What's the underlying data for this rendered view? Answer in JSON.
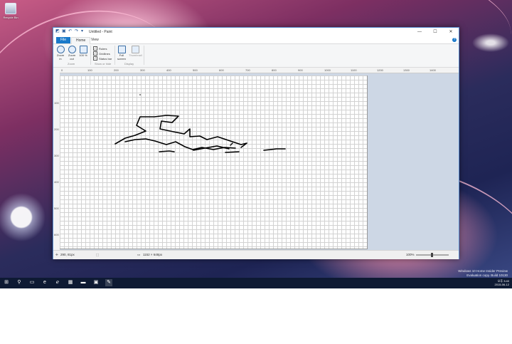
{
  "desktop": {
    "recycle_bin_label": "Recycle Bin"
  },
  "window": {
    "title": "Untitled - Paint",
    "controls": {
      "minimize": "—",
      "maximize": "☐",
      "close": "✕"
    }
  },
  "ribbon": {
    "tabs": [
      "File",
      "Home",
      "View"
    ],
    "zoom_group": {
      "zoom_in": "Zoom in",
      "zoom_out": "Zoom out",
      "hundred": "100 %",
      "label": "Zoom"
    },
    "show_hide": {
      "rulers": "Rulers",
      "gridlines": "Gridlines",
      "status_bar": "Status bar",
      "label": "Show or hide"
    },
    "display": {
      "full_screen": "Full screen",
      "thumbnail": "Thumbnail",
      "label": "Display"
    }
  },
  "rulers": {
    "horizontal": [
      "0",
      "100",
      "200",
      "300",
      "400",
      "500",
      "600",
      "700",
      "800",
      "900",
      "1000",
      "1100",
      "1200",
      "1300",
      "1400"
    ],
    "vertical": [
      "100",
      "200",
      "300",
      "400",
      "500",
      "600"
    ]
  },
  "statusbar": {
    "cursor_pos": "290, 81px",
    "image_size": "1152 × 648px",
    "zoom": "100%"
  },
  "taskbar": {
    "time": "오후 3:40",
    "date": "2015-06-12"
  },
  "watermark": {
    "line1": "Windows 10 Home Insider Preview",
    "line2": "Evaluation copy. Build 10130"
  },
  "colors": {
    "accent": "#1979ca",
    "workspace": "#cdd7e5"
  }
}
